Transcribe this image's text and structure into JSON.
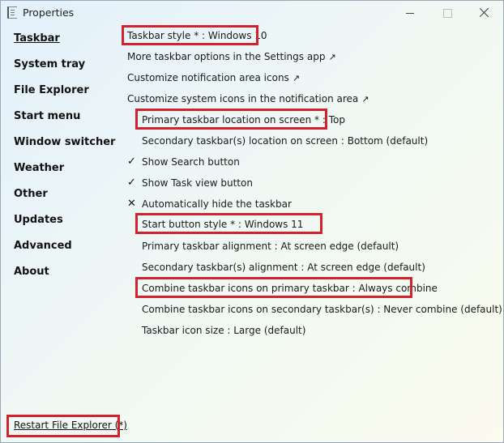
{
  "window": {
    "title": "Properties"
  },
  "sidebar": {
    "items": [
      {
        "label": "Taskbar",
        "selected": true
      },
      {
        "label": "System tray"
      },
      {
        "label": "File Explorer"
      },
      {
        "label": "Start menu"
      },
      {
        "label": "Window switcher"
      },
      {
        "label": "Weather"
      },
      {
        "label": "Other"
      },
      {
        "label": "Updates"
      },
      {
        "label": "Advanced"
      },
      {
        "label": "About"
      }
    ]
  },
  "options": [
    {
      "label": "Taskbar style * : Windows 10",
      "highlighted": true
    },
    {
      "label": "More taskbar options in the Settings app",
      "external_link": true
    },
    {
      "label": "Customize notification area icons",
      "external_link": true
    },
    {
      "label": "Customize system icons in the notification area",
      "external_link": true
    },
    {
      "label": "Primary taskbar location on screen * : Top",
      "highlighted": true
    },
    {
      "label": "Secondary taskbar(s) location on screen : Bottom (default)"
    },
    {
      "label": "Show Search button",
      "state": "checked"
    },
    {
      "label": "Show Task view button",
      "state": "checked"
    },
    {
      "label": "Automatically hide the taskbar",
      "state": "unchecked"
    },
    {
      "label": "Start button style * : Windows 11",
      "highlighted": true
    },
    {
      "label": "Primary taskbar alignment : At screen edge (default)"
    },
    {
      "label": "Secondary taskbar(s) alignment : At screen edge (default)"
    },
    {
      "label": "Combine taskbar icons on primary taskbar : Always combine",
      "highlighted": true
    },
    {
      "label": "Combine taskbar icons on secondary taskbar(s) : Never combine (default)"
    },
    {
      "label": "Taskbar icon size : Large (default)"
    }
  ],
  "symbols": {
    "external_arrow": "↗",
    "check": "✓",
    "cross": "✕"
  },
  "footer": {
    "restart_label": "Restart File Explorer (*)"
  },
  "colors": {
    "highlight_border": "#d1232e"
  }
}
